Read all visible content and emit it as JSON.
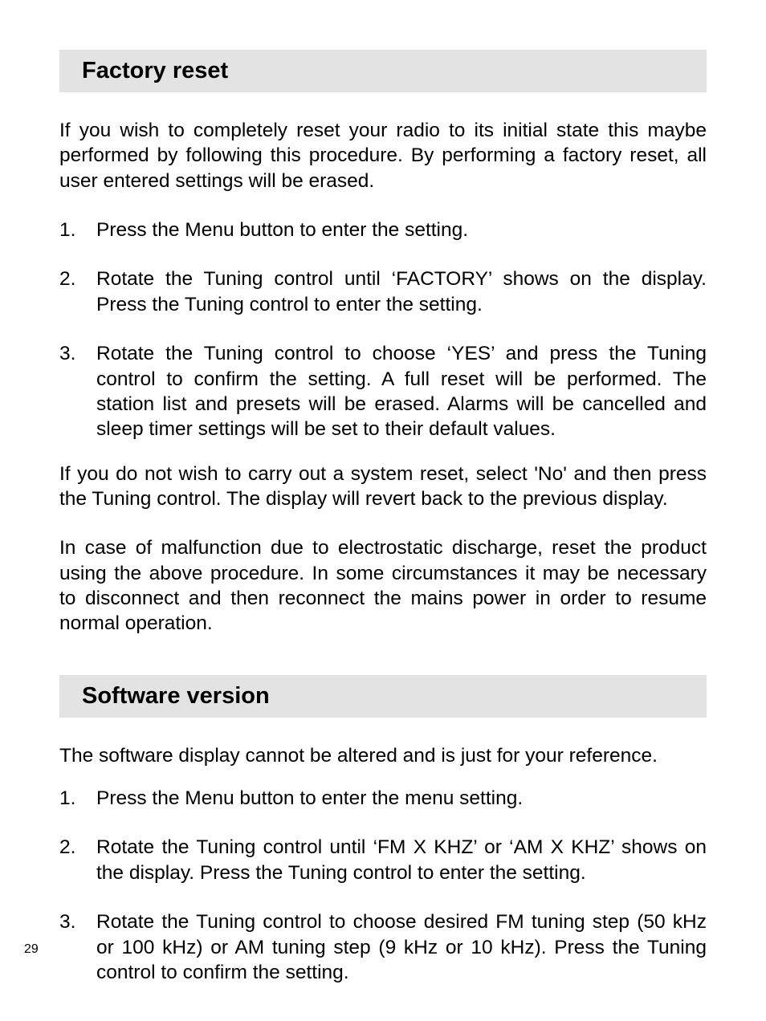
{
  "page_number": "29",
  "section1": {
    "heading": "Factory reset",
    "intro": "If you wish to completely reset your radio to its initial state this maybe performed by following this procedure. By performing a factory reset, all user entered settings will be erased.",
    "steps": [
      "Press the Menu button to enter the setting.",
      "Rotate the Tuning control until ‘FACTORY’ shows on the display. Press the Tuning control to enter the setting.",
      "Rotate the Tuning control to choose ‘YES’ and press the Tuning control to confirm the setting. A full reset will be performed. The station list and presets will be erased. Alarms will be cancelled and sleep timer settings will be set to their default values."
    ],
    "para_after1": "If you do not wish to carry out a system reset, select 'No' and then press the Tuning control. The display will revert back to the previous display.",
    "para_after2": "In case of malfunction due to electrostatic discharge, reset the product using the above procedure. In some circumstances it may be necessary to disconnect and then reconnect the mains power in order to resume normal operation."
  },
  "section2": {
    "heading": "Software version",
    "intro": "The software display cannot be altered and is just for your reference.",
    "steps": [
      "Press the Menu button to enter the menu setting.",
      "Rotate the Tuning control until ‘FM X KHZ’ or ‘AM X KHZ’ shows on the display. Press the Tuning control to enter the setting.",
      "Rotate the Tuning control to choose desired FM tuning step (50 kHz or 100 kHz) or AM tuning step (9 kHz or 10 kHz). Press the Tuning control to confirm the setting."
    ]
  }
}
